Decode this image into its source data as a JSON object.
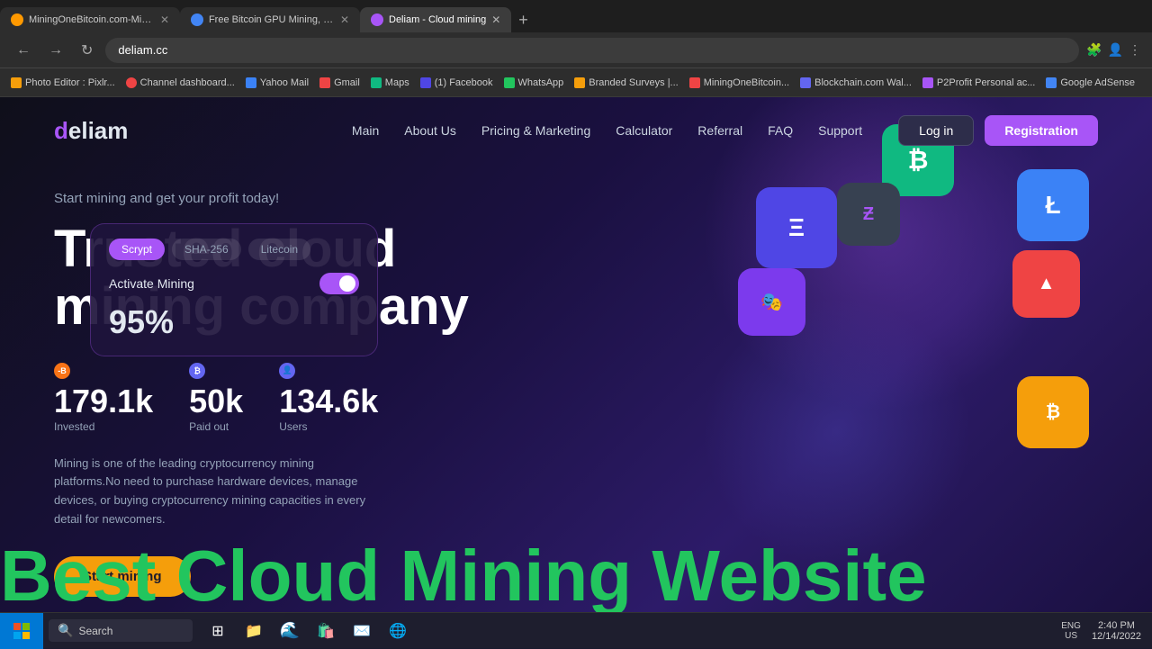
{
  "browser": {
    "tabs": [
      {
        "id": "tab1",
        "label": "MiningOneBitcoin.com-Mining...",
        "icon_color": "#f90",
        "active": false
      },
      {
        "id": "tab2",
        "label": "Free Bitcoin GPU Mining, Cloud...",
        "icon_color": "#4285f4",
        "active": false
      },
      {
        "id": "tab3",
        "label": "Deliam - Cloud mining",
        "icon_color": "#a855f7",
        "active": true
      }
    ],
    "url": "deliam.cc",
    "bookmarks": [
      "Photo Editor : Pixlr...",
      "Channel dashboard...",
      "Yahoo Mail",
      "Gmail",
      "Maps",
      "(1) Facebook",
      "WhatsApp",
      "Branded Surveys |...",
      "MiningOneBitcoin...",
      "Blockchain.com Wal...",
      "P2Profit Personal ac...",
      "Google AdSense"
    ]
  },
  "site": {
    "logo": "deliam",
    "nav": {
      "links": [
        "Main",
        "About Us",
        "Pricing & Marketing",
        "Calculator",
        "Referral",
        "FAQ",
        "Support"
      ],
      "login_label": "Log in",
      "register_label": "Registration"
    },
    "hero": {
      "subtitle": "Start mining and get your profit today!",
      "title": "Trusted cloud mining company",
      "stats": [
        {
          "number": "179.1k",
          "label": "Invested"
        },
        {
          "number": "50k",
          "label": "Paid out"
        },
        {
          "number": "134.6k",
          "label": "Users"
        }
      ],
      "description": "Mining is one of the leading cryptocurrency mining platforms.No need to purchase hardware devices, manage devices, or buying cryptocurrency mining capacities in every detail for newcomers.",
      "cta_label": "Start mining"
    },
    "mining_panel": {
      "tabs": [
        "Scrypt",
        "SHA-256",
        "Litecoin"
      ],
      "active_tab": "Scrypt",
      "activate_label": "Activate Mining",
      "percent": "95%"
    },
    "overlay_text": "Best Cloud Mining Website"
  },
  "taskbar": {
    "search_placeholder": "Search",
    "time": "2:40 PM",
    "date": "12/14/2022",
    "language": "ENG\nUS"
  }
}
